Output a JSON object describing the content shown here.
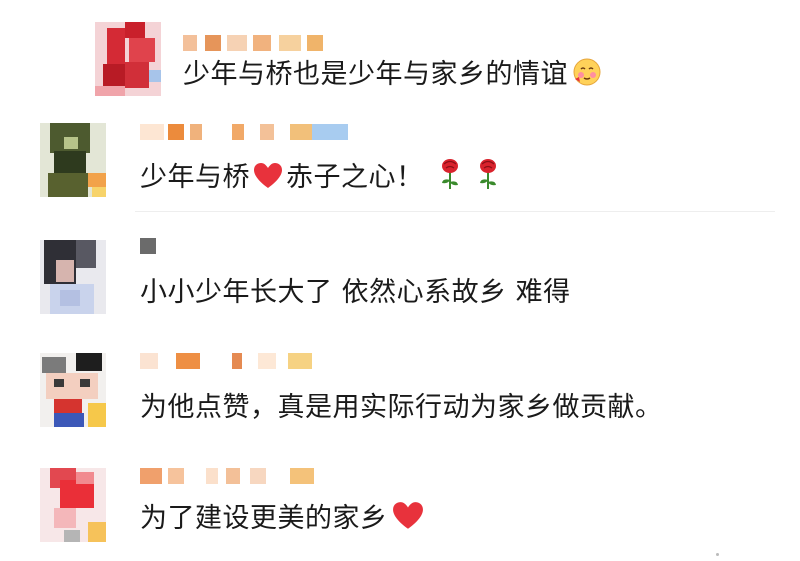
{
  "comments": [
    {
      "text": "少年与桥也是少年与家乡的情谊",
      "emojis": [
        "shy-smile-emoji"
      ]
    },
    {
      "text": "少年与桥",
      "emojis": [
        "red-heart-emoji"
      ],
      "text_after": "赤子之心！",
      "trailing_emojis": [
        "rose-emoji",
        "rose-emoji"
      ]
    },
    {
      "text": "小小少年长大了 依然心系故乡 难得",
      "emojis": []
    },
    {
      "text": "为他点赞，真是用实际行动为家乡做贡献。",
      "emojis": []
    },
    {
      "text": "为了建设更美的家乡",
      "emojis": [
        "red-heart-emoji"
      ]
    }
  ],
  "colors": {
    "heart": "#e8323c",
    "rose": "#d9232d",
    "leaf": "#3a8a2c",
    "divider": "#eeeeee"
  }
}
